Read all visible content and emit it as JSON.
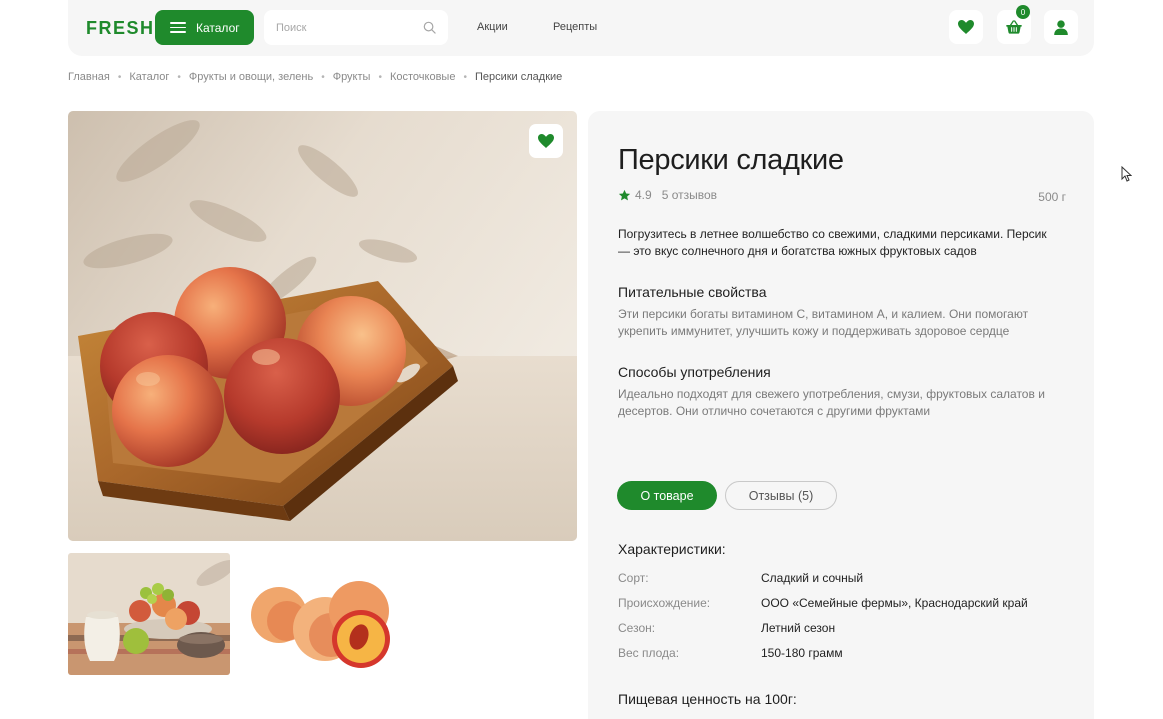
{
  "header": {
    "logo": "FRESH",
    "catalog_label": "Каталог",
    "search_placeholder": "Поиск",
    "nav": [
      "Акции",
      "Рецепты"
    ],
    "cart_count": "0",
    "icons": [
      "heart-icon",
      "basket-icon",
      "user-icon",
      "search-icon",
      "menu-icon"
    ]
  },
  "breadcrumb": [
    "Главная",
    "Каталог",
    "Фрукты и овощи, зелень",
    "Фрукты",
    "Косточковые",
    "Персики сладкие"
  ],
  "product": {
    "title": "Персики сладкие",
    "rating": "4.9",
    "reviews": "5 отзывов",
    "weight": "500 г",
    "description": "Погрузитесь в летнее волшебство со свежими, сладкими персиками. Персик — это вкус солнечного дня и богатства южных фруктовых садов",
    "nutrition_title": "Питательные свойства",
    "nutrition_text": "Эти персики богаты витамином С, витамином А, и калием. Они помогают укрепить иммунитет, улучшить кожу и поддерживать здоровое сердце",
    "usage_title": "Способы употребления",
    "usage_text": "Идеально подходят для свежего употребления, смузи, фруктовых салатов и десертов. Они отлично сочетаются с другими фруктами"
  },
  "tabs": {
    "about": "О товаре",
    "reviews": "Отзывы (5)"
  },
  "characteristics": {
    "title": "Характеристики:",
    "rows": [
      {
        "key": "Сорт:",
        "value": "Сладкий и сочный"
      },
      {
        "key": "Происхождение:",
        "value": "ООО «Семейные фермы», Краснодарский край"
      },
      {
        "key": "Сезон:",
        "value": "Летний сезон"
      },
      {
        "key": "Вес плода:",
        "value": "150-180 грамм"
      }
    ]
  },
  "nutrition_value_title": "Пищевая ценность на 100г:",
  "colors": {
    "brand": "#1f8a2c",
    "panel": "#f6f6f6",
    "muted_text": "#8a8a8a"
  }
}
